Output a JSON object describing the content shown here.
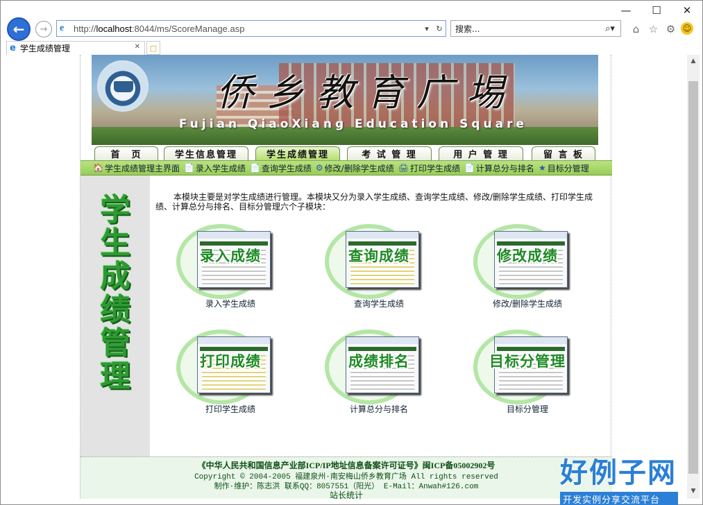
{
  "browser": {
    "url_prefix": "http://",
    "url_host": "localhost",
    "url_rest": ":8044/ms/ScoreManage.asp",
    "search_placeholder": "搜索...",
    "tab_title": "学生成绩管理",
    "window_controls": [
      "—",
      "☐",
      "✕"
    ]
  },
  "site": {
    "banner_title": "侨乡教育广埸",
    "banner_subtitle": "Fujian QiaoXiang Education Square",
    "nav": [
      "首　页",
      "学生信息管理",
      "学生成绩管理",
      "考 试 管 理",
      "用 户 管 理",
      "留 言 板"
    ],
    "active_nav_index": 2,
    "subnav": [
      {
        "icon": "🏠",
        "label": "学生成绩管理主界面"
      },
      {
        "icon": "📄",
        "label": "录入学生成绩"
      },
      {
        "icon": "📄",
        "label": "查询学生成绩"
      },
      {
        "icon": "⚙",
        "label": "修改/删除学生成绩"
      },
      {
        "icon": "🖨",
        "label": "打印学生成绩"
      },
      {
        "icon": "📄",
        "label": "计算总分与排名"
      },
      {
        "icon": "★",
        "label": "目标分管理"
      }
    ],
    "sidebar_title": [
      "学",
      "生",
      "成",
      "绩",
      "管",
      "理"
    ],
    "intro_line1": "本模块主要是对学生成绩进行管理。本模块又分为录入学生成绩、查询学生成绩、修改/删除学生成绩、打印学生成",
    "intro_line2": "绩、计算总分与排名、目标分管理六个子模块：",
    "modules": [
      {
        "label": "录入成绩",
        "caption": "录入学生成绩"
      },
      {
        "label": "查询成绩",
        "caption": "查询学生成绩"
      },
      {
        "label": "修改成绩",
        "caption": "修改/删除学生成绩"
      },
      {
        "label": "打印成绩",
        "caption": "打印学生成绩"
      },
      {
        "label": "成绩排名",
        "caption": "计算总分与排名"
      },
      {
        "label": "目标分管理",
        "caption": "目标分管理"
      }
    ],
    "footer": {
      "line1": "《中华人民共和国信息产业部ICP/IP地址信息备案许可证号》闽ICP备05002902号",
      "line2": "Copyright © 2004-2005  福建泉州·南安梅山侨乡教育广场  All rights reserved",
      "line3": "制作·维护：陈志洪 联系QQ：8057551（阳光） E-Mail：Anwah#126.com",
      "line4": "站长统计"
    }
  },
  "watermark": {
    "title": "好例子网",
    "tagline": "开发实例分享交流平台"
  }
}
